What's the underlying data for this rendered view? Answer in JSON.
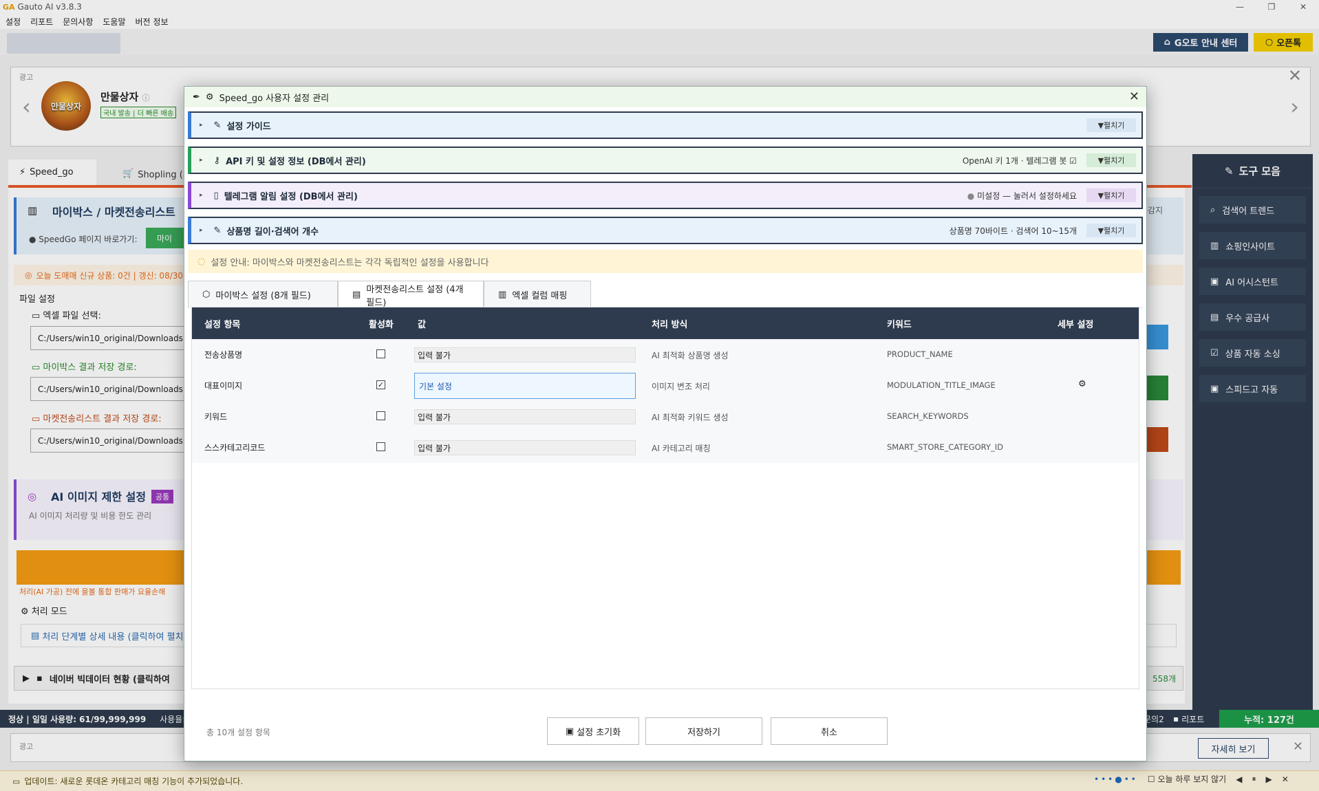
{
  "app": {
    "title": "Gauto AI v3.8.3",
    "logo": "GA"
  },
  "menu": [
    "설정",
    "리포트",
    "문의사항",
    "도움말",
    "버전 정보"
  ],
  "top_buttons": {
    "guide": "G오토 안내 센터",
    "open_chat": "오픈톡"
  },
  "ad": {
    "label": "광고",
    "logo_text": "만물상자",
    "title": "만물상자",
    "tag": "국내 발송 | 더 빠른 배송"
  },
  "main_tabs": [
    "Speed_go",
    "Shopling (서"
  ],
  "mybox_section": {
    "title": "마이박스 / 마켓전송리스트 ",
    "shortcut": "SpeedGo 페이지 바로가기:",
    "button": "마이",
    "right_text": "-감지"
  },
  "today_line": "오늘 도매매 신규 상품: 0건 | 갱신: 08/30",
  "file_settings": {
    "title": "파일 설정",
    "excel_label": "엑셀 파일 선택:",
    "excel_path": "C:/Users/win10_original/Downloads",
    "mybox_label": "마이박스 결과 저장 경로:",
    "mybox_path": "C:/Users/win10_original/Downloads",
    "market_label": "마켓전송리스트 결과 저장 경로:",
    "market_path": "C:/Users/win10_original/Downloads"
  },
  "ai_section": {
    "title": "AI 이미지 제한 설정",
    "badge": "공통",
    "subtitle": "AI 이미지 처리량 및 비용 한도 관리"
  },
  "warn_text": "처리(AI 가공) 전에 을볼 통합 판매가 요율손해 ",
  "proc_mode": "처리 모드",
  "proc_detail": "처리 단계별 상세 내용 (클릭하여 펼치",
  "naver_row": {
    "title": "네이버 빅데이터 현황 (클릭하여",
    "count": "558개"
  },
  "toolbox": {
    "title": "도구 모음",
    "items": [
      "검색어 트렌드",
      "쇼핑인사이트",
      "AI 어시스턴트",
      "우수 공급사",
      "상품 자동 소싱",
      "스피드고 자동"
    ]
  },
  "status": {
    "left": "정상 | 일일 사용량: 61/99,999,999",
    "usage": "사용율:",
    "ask": "문의2",
    "report": "리포트",
    "total": "누적: 127건"
  },
  "bottom_ad": {
    "label": "광고",
    "detail_button": "자세히 보기"
  },
  "update_bar": {
    "text": "업데이트: 새로운 롯데온 카테고리 매칭 기능이 추가되었습니다.",
    "hide_today": "오늘 하루 보지 않기"
  },
  "modal": {
    "title": "Speed_go 사용자 설정 관리",
    "accordions": [
      {
        "title": "설정 가이드",
        "meta": "",
        "expand": "펼치기",
        "color": "#e8f2fb",
        "border": "#3a7bd5",
        "btn_bg": "#d8e6f4"
      },
      {
        "title": "API 키 및 설정 정보 (DB에서 관리)",
        "meta": "OpenAI 키 1개 · 텔레그램 봇",
        "expand": "펼치기",
        "color": "#eef8ee",
        "border": "#2aa05a",
        "btn_bg": "#d4ecd8"
      },
      {
        "title": "텔레그램 알림 설정 (DB에서 관리)",
        "meta": "미설정 — 눌러서 설정하세요",
        "expand": "펼치기",
        "color": "#f4eefb",
        "border": "#8a4ad5",
        "btn_bg": "#e6d8f2"
      },
      {
        "title": "상품명 길이·검색어 개수",
        "meta": "상품명 70바이트 · 검색어 10~15개",
        "expand": "펼치기",
        "color": "#e8f2fb",
        "border": "#3a7bd5",
        "btn_bg": "#d8e6f4"
      }
    ],
    "notice": "설정 안내: 마이박스와 마켓전송리스트는 각각 독립적인 설정을 사용합니다",
    "tabs": [
      "마이박스 설정 (8개 필드)",
      "마켓전송리스트 설정 (4개 필드)",
      "엑셀 컬럼 매핑"
    ],
    "active_tab": 1,
    "table": {
      "headers": [
        "설정 항목",
        "활성화",
        "값",
        "처리 방식",
        "키워드",
        "세부 설정"
      ],
      "rows": [
        {
          "item": "전송상품명",
          "enabled": false,
          "value": "입력 불가",
          "editable": false,
          "method": "AI 최적화 상품명 생성",
          "keyword": "PRODUCT_NAME",
          "gear": false
        },
        {
          "item": "대표이미지",
          "enabled": true,
          "value": "기본 설정",
          "editable": true,
          "method": "이미지 변조 처리",
          "keyword": "MODULATION_TITLE_IMAGE",
          "gear": true
        },
        {
          "item": "키워드",
          "enabled": false,
          "value": "입력 불가",
          "editable": false,
          "method": "AI 최적화 키워드 생성",
          "keyword": "SEARCH_KEYWORDS",
          "gear": false
        },
        {
          "item": "스스카테고리코드",
          "enabled": false,
          "value": "입력 불가",
          "editable": false,
          "method": "AI 카테고리 매칭",
          "keyword": "SMART_STORE_CATEGORY_ID",
          "gear": false
        }
      ]
    },
    "footer": {
      "count": "총 10개 설정 항목",
      "reset": "설정 초기화",
      "save": "저장하기",
      "cancel": "취소"
    }
  }
}
